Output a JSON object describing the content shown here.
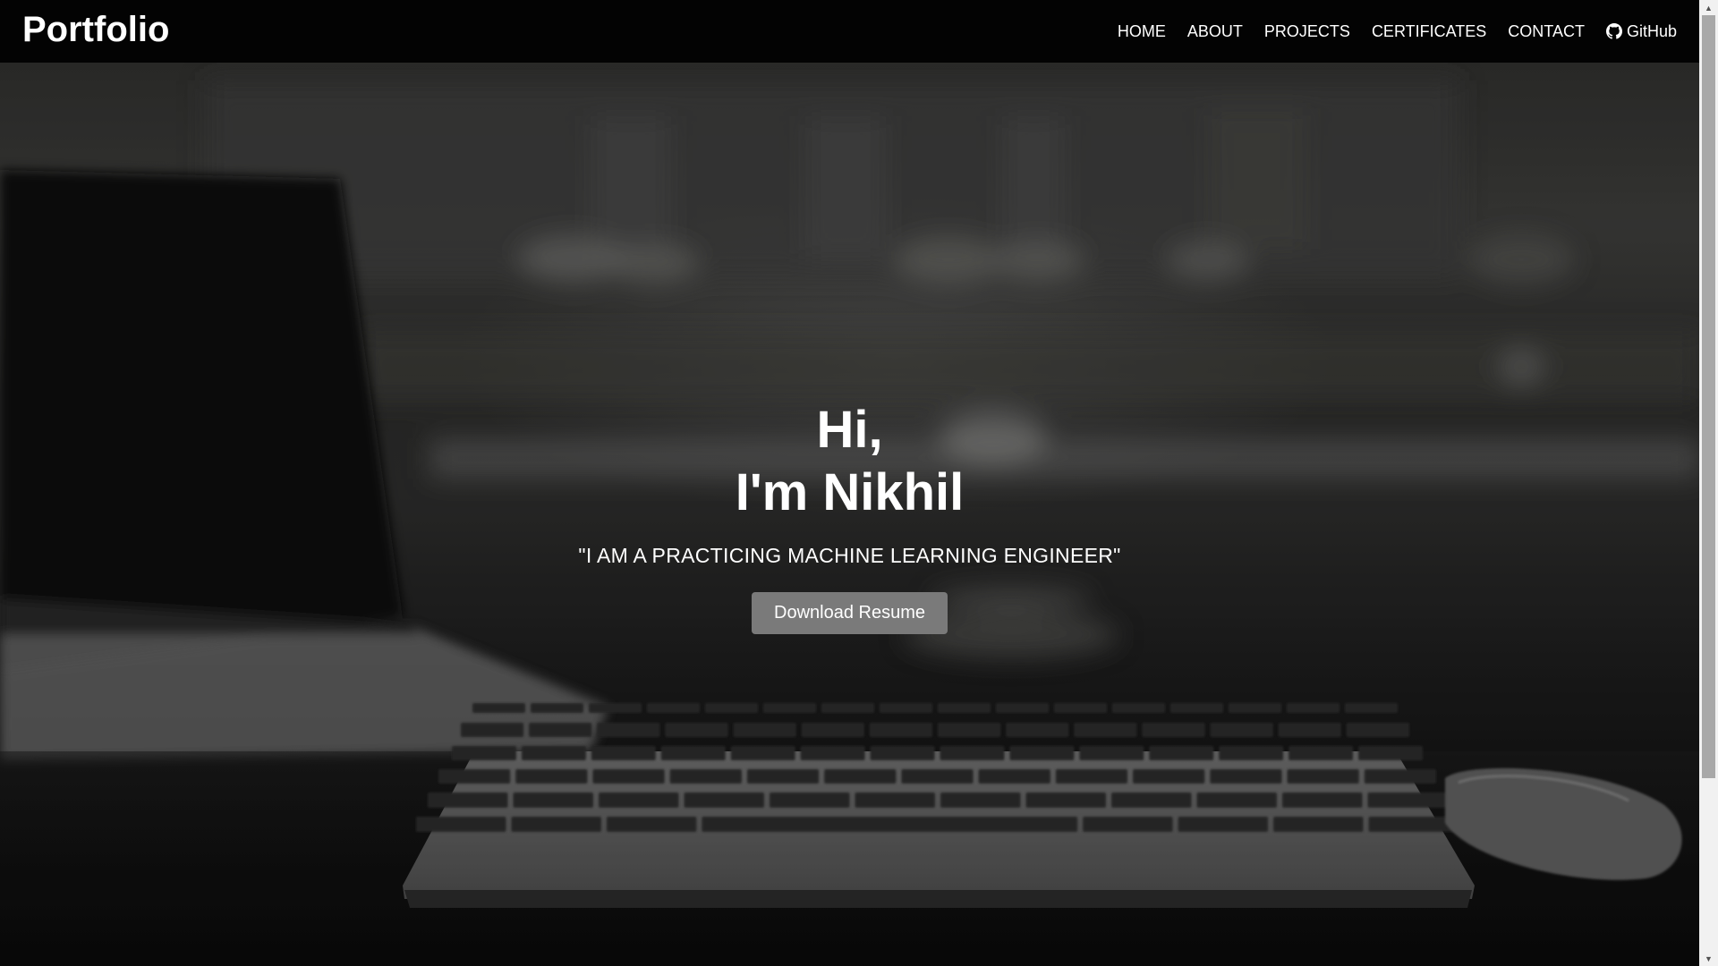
{
  "brand": "Portfolio",
  "nav": {
    "items": [
      {
        "label": "HOME"
      },
      {
        "label": "ABOUT"
      },
      {
        "label": "PROJECTS"
      },
      {
        "label": "CERTIFICATES"
      },
      {
        "label": "CONTACT"
      }
    ],
    "github_label": "GitHub",
    "github_icon": "github-icon"
  },
  "hero": {
    "greeting_line1": "Hi,",
    "greeting_line2": "I'm Nikhil",
    "tagline": "\"I AM A PRACTICING MACHINE LEARNING ENGINEER\"",
    "button_label": "Download Resume",
    "background_image": "blurred desk with laptop, keyboard and mouse (grayscale)"
  },
  "colors": {
    "navbar_bg": "#030303",
    "button_bg": "#7a7a7a",
    "text": "#ffffff"
  },
  "scrollbar": {
    "position_fraction": 0.0
  }
}
